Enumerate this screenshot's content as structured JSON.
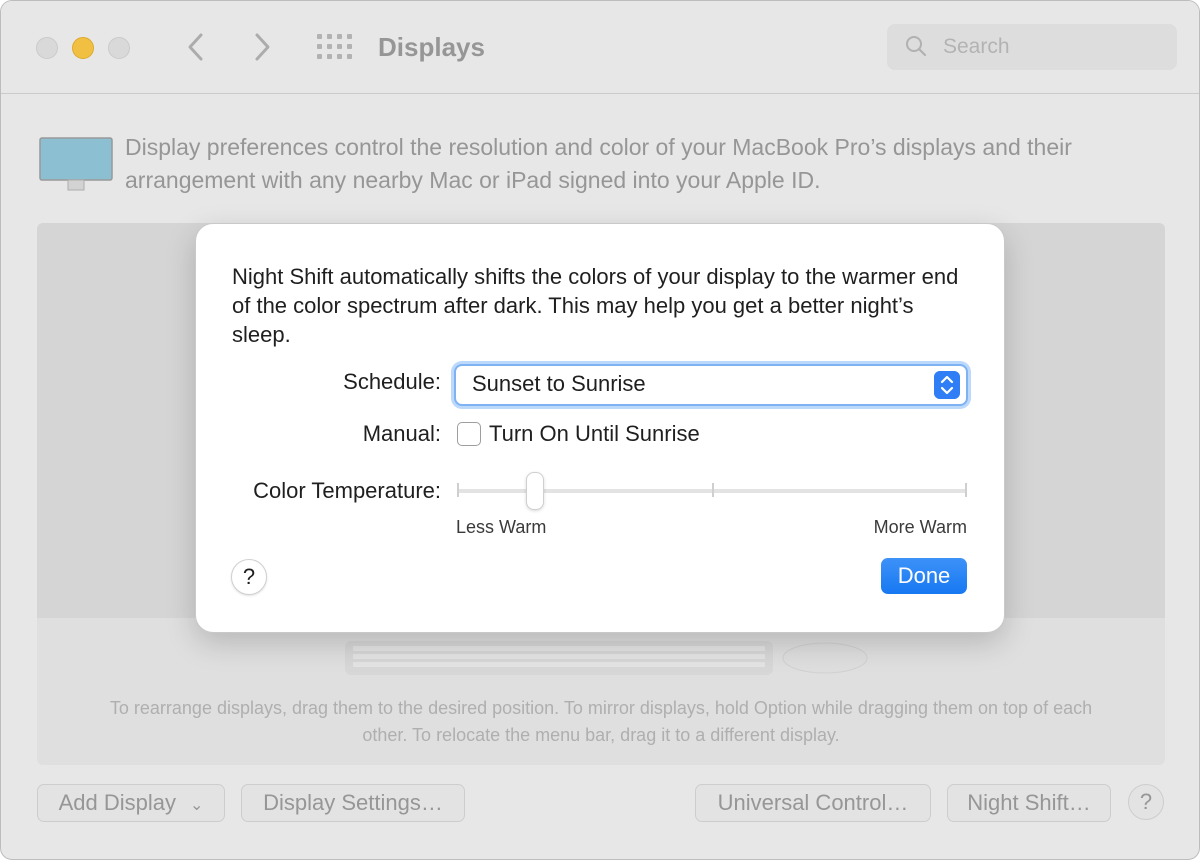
{
  "window": {
    "title": "Displays",
    "search": {
      "placeholder": "Search"
    }
  },
  "main": {
    "description": "Display preferences control the resolution and color of your MacBook Pro’s displays and their arrangement with any nearby Mac or iPad signed into your Apple ID.",
    "hint": "To rearrange displays, drag them to the desired position. To mirror displays, hold Option while dragging them on top of each other. To relocate the menu bar, drag it to a different display."
  },
  "toolbar": {
    "add_display": "Add Display",
    "display_settings": "Display Settings…",
    "universal_control": "Universal Control…",
    "night_shift": "Night Shift…",
    "help": "?"
  },
  "night_shift_sheet": {
    "description": "Night Shift automatically shifts the colors of your display to the warmer end of the color spectrum after dark. This may help you get a better night’s sleep.",
    "schedule_label": "Schedule:",
    "schedule_value": "Sunset to Sunrise",
    "manual_label": "Manual:",
    "manual_checkbox_label": "Turn On Until Sunrise",
    "manual_checked": false,
    "color_temp_label": "Color Temperature:",
    "color_temp_min_label": "Less Warm",
    "color_temp_max_label": "More Warm",
    "color_temp_value": 0.15,
    "help": "?",
    "done": "Done"
  },
  "colors": {
    "accent": "#1778f2",
    "minimize": "#f6c445",
    "display_screen": "#8fc3d6"
  }
}
